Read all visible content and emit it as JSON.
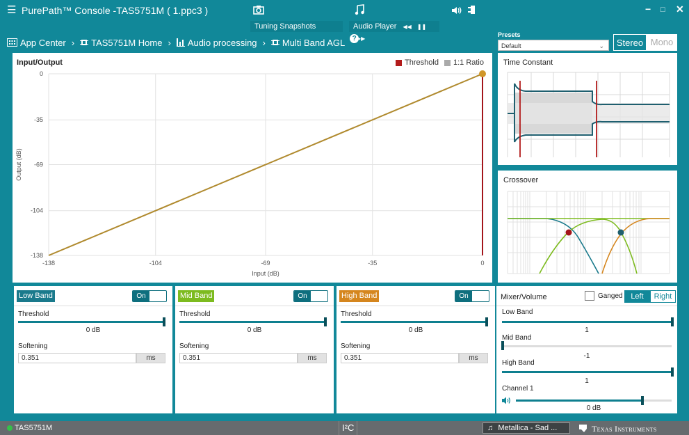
{
  "window": {
    "title": "PurePath™ Console -TAS5751M ( 1.ppc3 )",
    "menu_icon": "hamburger-icon",
    "controls": [
      "−",
      "□",
      "✕"
    ]
  },
  "toolbar": {
    "tuning_snapshots": "Tuning Snapshots",
    "audio_player": "Audio Player",
    "player_controls": [
      "◀◀",
      "❚❚",
      "▶▶"
    ],
    "icons": [
      "camera-icon",
      "music-note-icon",
      "speaker-icon",
      "usb-plug-icon"
    ]
  },
  "breadcrumb": [
    "App Center",
    "TAS5751M Home",
    "Audio processing",
    "Multi Band AGL"
  ],
  "presets": {
    "label": "Presets",
    "value": "Default"
  },
  "output_mode": {
    "stereo": "Stereo",
    "mono": "Mono",
    "selected": "Stereo"
  },
  "io_panel": {
    "title": "Input/Output",
    "legend": [
      {
        "name": "Threshold",
        "color": "#b31b1b"
      },
      {
        "name": "1:1 Ratio",
        "color": "#aaaaaa"
      }
    ]
  },
  "chart_data": {
    "type": "line",
    "title": "Input/Output",
    "xlabel": "Input (dB)",
    "ylabel": "Output (dB)",
    "xlim": [
      -138,
      0
    ],
    "ylim": [
      -138,
      0
    ],
    "xticks": [
      "-138",
      "-104",
      "-69",
      "-35",
      "0"
    ],
    "yticks": [
      "0",
      "-35",
      "-69",
      "-104",
      "-138"
    ],
    "series": [
      {
        "name": "1:1 Ratio",
        "x": [
          -138,
          0
        ],
        "y": [
          -138,
          0
        ],
        "color": "#b08a2e"
      }
    ],
    "threshold_x": 0,
    "grid": true,
    "legend": "top-right"
  },
  "time_constant": {
    "title": "Time Constant"
  },
  "crossover": {
    "title": "Crossover"
  },
  "bands": [
    {
      "name": "Low Band",
      "color": "#1a7a8c",
      "toggle": "On",
      "threshold_label": "Threshold",
      "threshold_value": "0 dB",
      "threshold_level": 1.0,
      "softening_label": "Softening",
      "softening_value": "0.351",
      "softening_unit": "ms"
    },
    {
      "name": "Mid Band",
      "color": "#7dbb1f",
      "toggle": "On",
      "threshold_label": "Threshold",
      "threshold_value": "0 dB",
      "threshold_level": 1.0,
      "softening_label": "Softening",
      "softening_value": "0.351",
      "softening_unit": "ms"
    },
    {
      "name": "High Band",
      "color": "#d5861e",
      "toggle": "On",
      "threshold_label": "Threshold",
      "threshold_value": "0 dB",
      "threshold_level": 1.0,
      "softening_label": "Softening",
      "softening_value": "0.351",
      "softening_unit": "ms"
    }
  ],
  "mixer": {
    "title": "Mixer/Volume",
    "ganged_label": "Ganged",
    "ganged": false,
    "left": "Left",
    "right": "Right",
    "selected": "Left",
    "low_band": {
      "label": "Low Band",
      "value": "1",
      "level": 1.0
    },
    "mid_band": {
      "label": "Mid Band",
      "value": "-1",
      "level": 0.0
    },
    "high_band": {
      "label": "High Band",
      "value": "1",
      "level": 1.0
    },
    "channel1": {
      "label": "Channel 1",
      "value": "0 dB",
      "level": 0.82
    }
  },
  "status": {
    "device": "TAS5751M",
    "bus": "I²C",
    "now_playing": "Metallica - Sad ...",
    "brand": "Texas Instruments"
  }
}
